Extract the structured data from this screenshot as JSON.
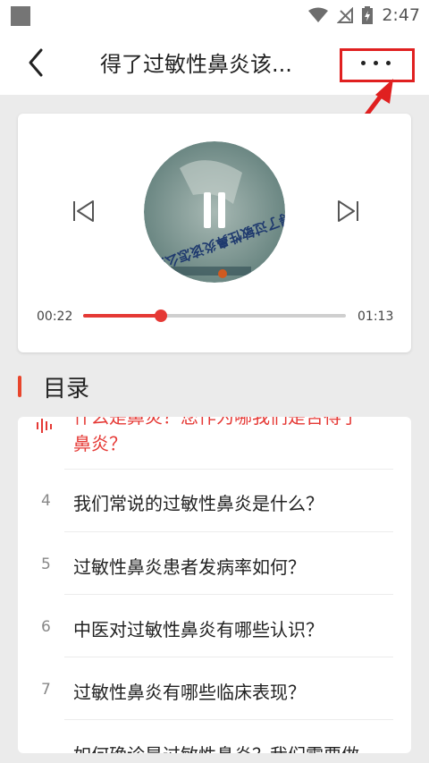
{
  "status_bar": {
    "time": "2:47"
  },
  "header": {
    "title": "得了过敏性鼻炎该..."
  },
  "player": {
    "current_time": "00:22",
    "total_time": "01:13",
    "progress": 0.297,
    "cover_text": "得了过敏性鼻炎该怎么办？"
  },
  "toc": {
    "heading": "目录",
    "current_item": {
      "line1": "什么是鼻炎？您作为哪我们是否得了",
      "line2": "鼻炎？"
    },
    "items": [
      {
        "num": "4",
        "text": "我们常说的过敏性鼻炎是什么？"
      },
      {
        "num": "5",
        "text": "过敏性鼻炎患者发病率如何？"
      },
      {
        "num": "6",
        "text": "中医对过敏性鼻炎有哪些认识？"
      },
      {
        "num": "7",
        "text": "过敏性鼻炎有哪些临床表现？"
      },
      {
        "num": "",
        "text": "如何确诊是过敏性鼻炎？我们需要做"
      }
    ]
  },
  "colors": {
    "accent": "#e53935",
    "annotation": "#e02020"
  }
}
